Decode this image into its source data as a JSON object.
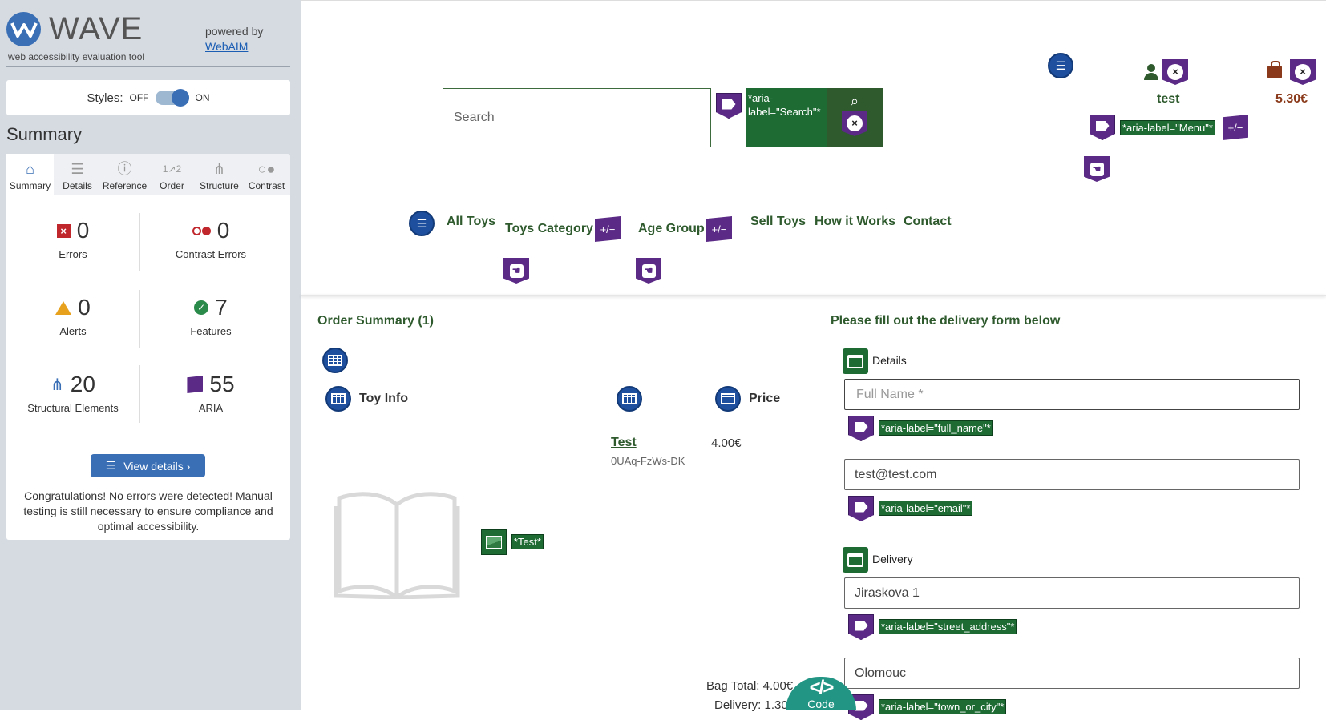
{
  "wave": {
    "brand": "WAVE",
    "subtitle": "web accessibility evaluation tool",
    "powered_by": "powered by",
    "powered_link": "WebAIM",
    "styles_label": "Styles:",
    "styles_off": "OFF",
    "styles_on": "ON",
    "summary_heading": "Summary",
    "tabs": [
      {
        "label": "Summary",
        "icon": "home-icon"
      },
      {
        "label": "Details",
        "icon": "list-icon"
      },
      {
        "label": "Reference",
        "icon": "info-icon"
      },
      {
        "label": "Order",
        "icon": "order-icon"
      },
      {
        "label": "Structure",
        "icon": "structure-icon"
      },
      {
        "label": "Contrast",
        "icon": "contrast-icon"
      }
    ],
    "stats": {
      "errors": {
        "value": "0",
        "label": "Errors"
      },
      "contrast_errors": {
        "value": "0",
        "label": "Contrast Errors"
      },
      "alerts": {
        "value": "0",
        "label": "Alerts"
      },
      "features": {
        "value": "7",
        "label": "Features"
      },
      "structural": {
        "value": "20",
        "label": "Structural Elements"
      },
      "aria": {
        "value": "55",
        "label": "ARIA"
      }
    },
    "view_details": "View details ›",
    "congrats": "Congratulations! No errors were detected! Manual testing is still necessary to ensure compliance and optimal accessibility.",
    "colors": {
      "accent": "#3a6fb5",
      "error": "#c0272d",
      "aria": "#5b2a86",
      "feature": "#1e6b34"
    }
  },
  "page": {
    "search_placeholder": "Search",
    "search_aria_label": "*aria-label=\"Search\"*",
    "user_name": "test",
    "bag_total": "5.30€",
    "menu_aria_label": "*aria-label=\"Menu\"*",
    "nav": {
      "all_toys": "All Toys",
      "toys_category": "Toys Category",
      "age_group": "Age Group",
      "sell_toys": "Sell Toys",
      "how_it_works": "How it Works",
      "contact": "Contact"
    },
    "order": {
      "heading": "Order Summary (1)",
      "col_info": "Toy Info",
      "col_price": "Price",
      "product_name": "Test",
      "product_sku": "0UAq-FzWs-DK",
      "product_price": "4.00€",
      "image_alt": "*Test*",
      "bag_total": "Bag Total: 4.00€",
      "delivery": "Delivery: 1.30€"
    },
    "form": {
      "heading": "Please fill out the delivery form below",
      "details_legend": "Details",
      "full_name_placeholder": "Full Name *",
      "full_name_aria": "*aria-label=\"full_name\"*",
      "email_value": "test@test.com",
      "email_aria": "*aria-label=\"email\"*",
      "delivery_legend": "Delivery",
      "street_value": "Jiraskova 1",
      "street_aria": "*aria-label=\"street_address\"*",
      "city_value": "Olomouc",
      "city_aria": "*aria-label=\"town_or_city\"*"
    },
    "code_tab": {
      "symbol": "</>",
      "label": "Code"
    }
  }
}
